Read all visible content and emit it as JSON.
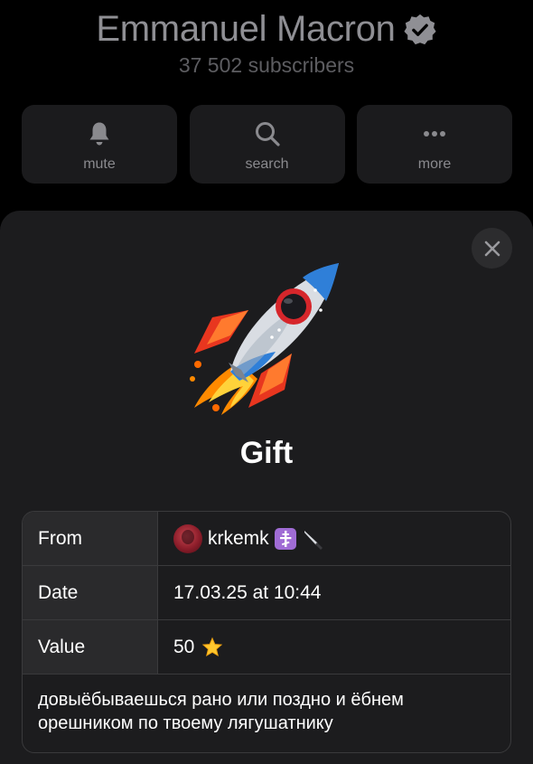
{
  "channel": {
    "title": "Emmanuel Macron",
    "verified_icon": "verified-badge-icon",
    "subscribers": "37 502 subscribers"
  },
  "actions": [
    {
      "label": "mute",
      "icon": "bell-icon"
    },
    {
      "label": "search",
      "icon": "search-icon"
    },
    {
      "label": "more",
      "icon": "more-dots-icon"
    }
  ],
  "gift_sheet": {
    "close_icon": "close-icon",
    "image_icon": "rocket-icon",
    "title": "Gift",
    "details": {
      "from_label": "From",
      "from_value": "krkemk",
      "from_badges": [
        "orthodox-cross-icon",
        "knife-icon"
      ],
      "date_label": "Date",
      "date_value": "17.03.25 at 10:44",
      "value_label": "Value",
      "value_amount": "50",
      "value_icon": "star-icon"
    },
    "message": "довыёбываешься рано или поздно и ёбнем орешником по твоему лягушатнику"
  },
  "colors": {
    "background": "#000000",
    "sheet": "#1c1c1e",
    "table_label_bg": "#2a2a2c",
    "border": "#3a3a3c",
    "dim_text": "#8f8f94"
  }
}
